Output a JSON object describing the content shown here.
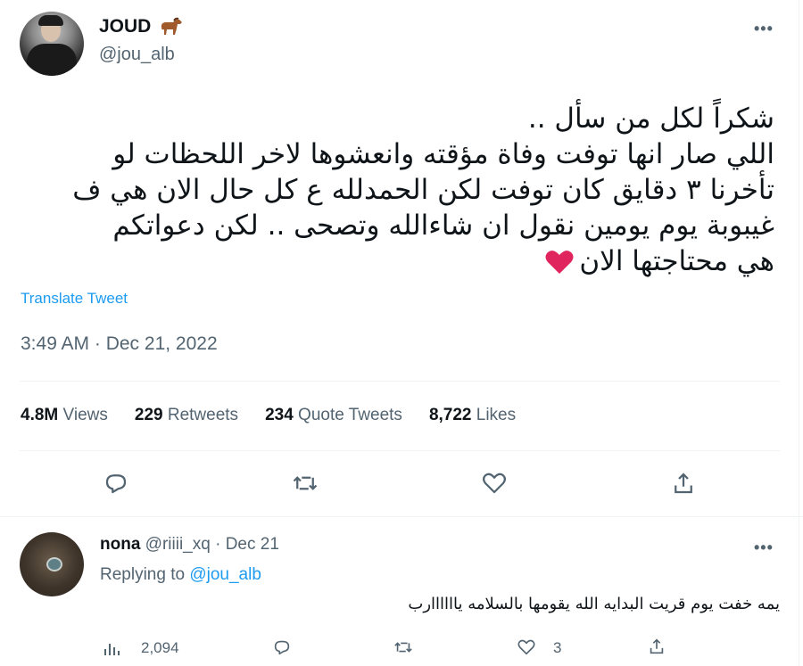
{
  "tweet": {
    "display_name": "JOUD",
    "handle": "@jou_alb",
    "lines": [
      "شكراً لكل من سأل ..",
      "اللي صار انها توفت وفاة مؤقته وانعشوها لاخر اللحظات لو",
      "تأخرنا ٣ دقايق كان توفت لكن الحمدلله ع كل حال الان هي ف",
      "غيبوبة يوم يومين نقول ان شاءالله وتصحى .. لكن دعواتكم",
      "هي محتاجتها الان"
    ],
    "translate": "Translate Tweet",
    "timestamp": "3:49 AM · Dec 21, 2022",
    "stats": [
      {
        "value": "4.8M",
        "label": "Views"
      },
      {
        "value": "229",
        "label": "Retweets"
      },
      {
        "value": "234",
        "label": "Quote Tweets"
      },
      {
        "value": "8,722",
        "label": "Likes"
      }
    ]
  },
  "reply": {
    "name": "nona",
    "handle": "@riiii_xq",
    "date": "· Dec 21",
    "replying_prefix": "Replying to",
    "replying_handle": "@jou_alb",
    "text": "يمه خفت يوم قريت البدايه الله يقومها بالسلامه ياااااارب",
    "views": "2,094",
    "likes": "3"
  },
  "icons": {
    "more": "more-horizontal-icon",
    "reply": "reply-icon",
    "retweet": "retweet-icon",
    "like": "heart-icon",
    "share": "share-icon",
    "views": "analytics-icon"
  },
  "colors": {
    "accent": "#1d9bf0",
    "secondary_text": "#536471",
    "heart_emoji": "#e0245e"
  }
}
